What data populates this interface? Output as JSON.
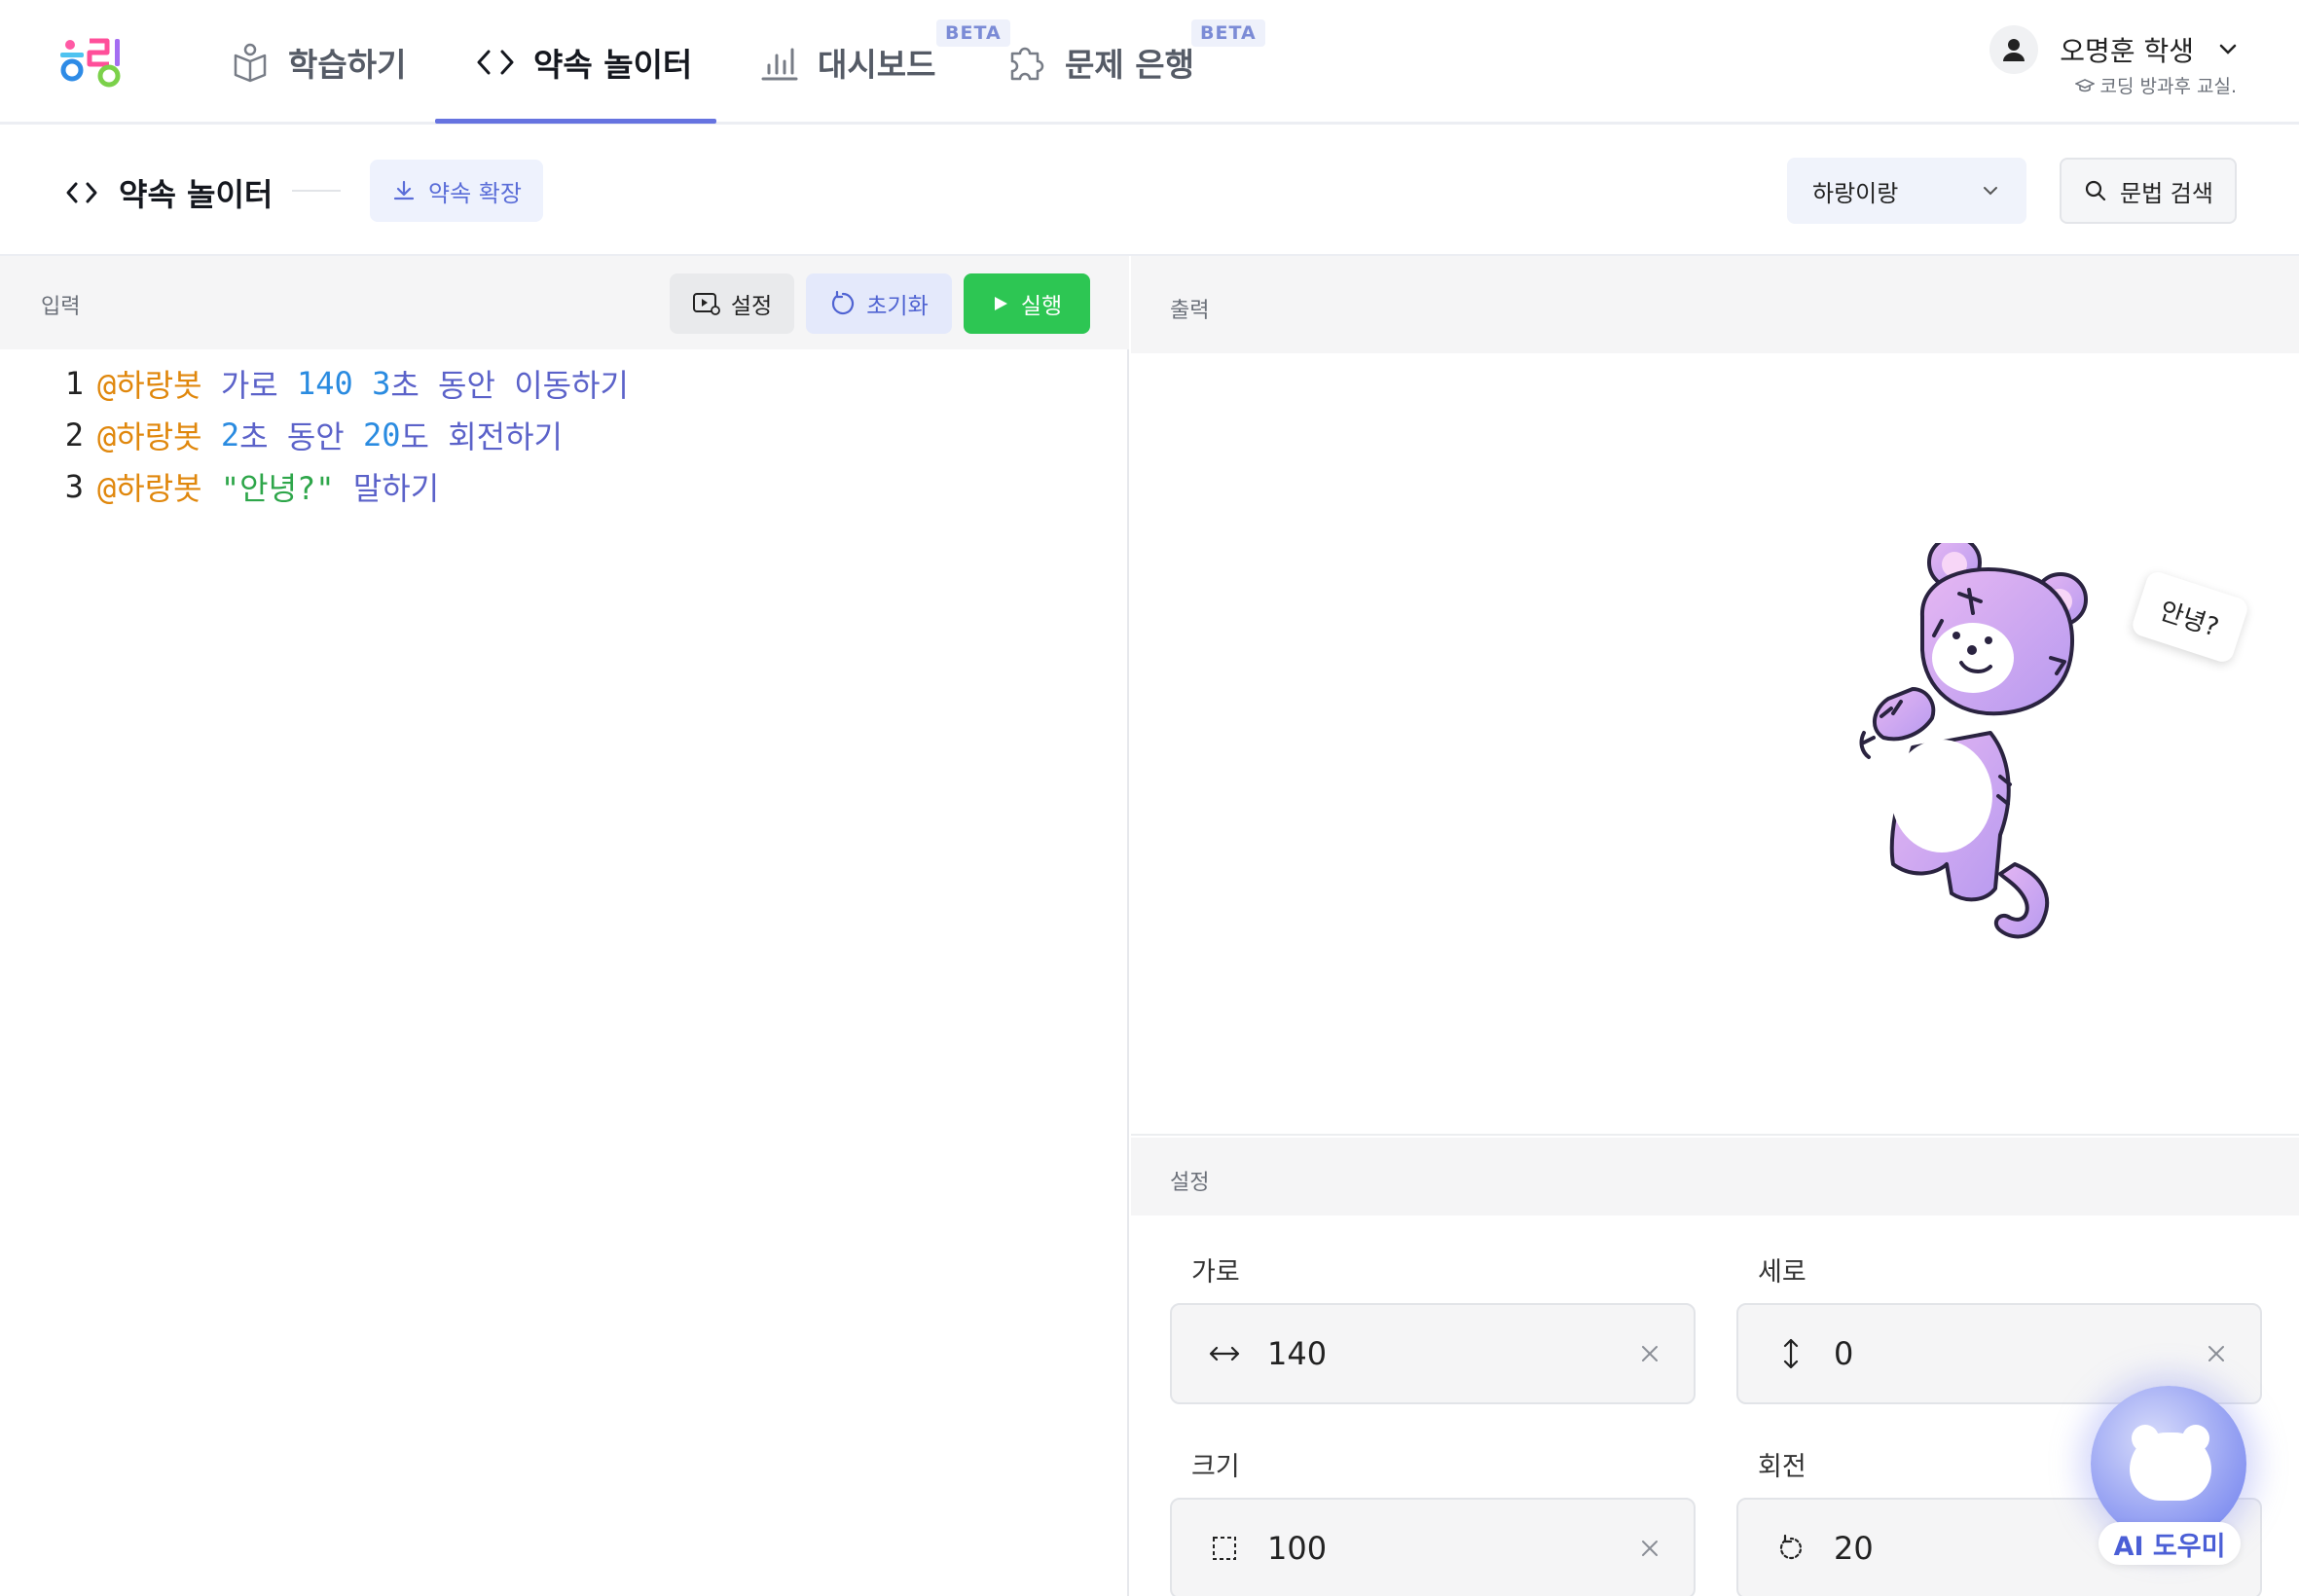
{
  "nav": {
    "items": [
      {
        "label": "학습하기",
        "icon": "book-icon"
      },
      {
        "label": "약속 놀이터",
        "icon": "code-icon"
      },
      {
        "label": "대시보드",
        "icon": "bar-chart-icon",
        "badge": "BETA"
      },
      {
        "label": "문제 은행",
        "icon": "puzzle-icon",
        "badge": "BETA"
      }
    ],
    "active_index": 1
  },
  "user": {
    "name": "오명훈 학생",
    "class_name": "코딩 방과후 교실."
  },
  "subheader": {
    "title": "약속 놀이터",
    "extend_button": "약속 확장",
    "theme_select": "하랑이랑",
    "search_button": "문법 검색"
  },
  "editor": {
    "panel_label": "입력",
    "settings_button": "설정",
    "reset_button": "초기화",
    "run_button": "실행",
    "lines": [
      {
        "num": "1",
        "tokens": [
          {
            "text": "@하랑봇",
            "type": "mention"
          },
          {
            "text": " 가로 ",
            "type": "kw"
          },
          {
            "text": "140",
            "type": "num"
          },
          {
            "text": " ",
            "type": "kw"
          },
          {
            "text": "3",
            "type": "num"
          },
          {
            "text": "초 동안 이동하기",
            "type": "kw"
          }
        ]
      },
      {
        "num": "2",
        "tokens": [
          {
            "text": "@하랑봇",
            "type": "mention"
          },
          {
            "text": " ",
            "type": "kw"
          },
          {
            "text": "2",
            "type": "num"
          },
          {
            "text": "초 동안 ",
            "type": "kw"
          },
          {
            "text": "20",
            "type": "num"
          },
          {
            "text": "도 회전하기",
            "type": "kw"
          }
        ]
      },
      {
        "num": "3",
        "tokens": [
          {
            "text": "@하랑봇",
            "type": "mention"
          },
          {
            "text": " ",
            "type": "kw"
          },
          {
            "text": "\"안녕?\"",
            "type": "str"
          },
          {
            "text": " 말하기",
            "type": "kw"
          }
        ]
      }
    ]
  },
  "output": {
    "panel_label": "출력",
    "speech_bubble": "안녕?"
  },
  "settings": {
    "panel_label": "설정",
    "fields": {
      "width": {
        "label": "가로",
        "value": "140",
        "icon": "horizontal-arrows-icon"
      },
      "height": {
        "label": "세로",
        "value": "0",
        "icon": "vertical-arrows-icon"
      },
      "size": {
        "label": "크기",
        "value": "100",
        "icon": "dashed-square-icon"
      },
      "rotation": {
        "label": "회전",
        "value": "20",
        "icon": "rotate-icon"
      }
    }
  },
  "ai_helper": {
    "label": "AI 도우미"
  },
  "colors": {
    "accent": "#6673e0",
    "run_green": "#2dc653",
    "mention": "#e0870c",
    "keyword": "#5b62c9",
    "number": "#2a8be0",
    "string": "#2ea64a"
  }
}
